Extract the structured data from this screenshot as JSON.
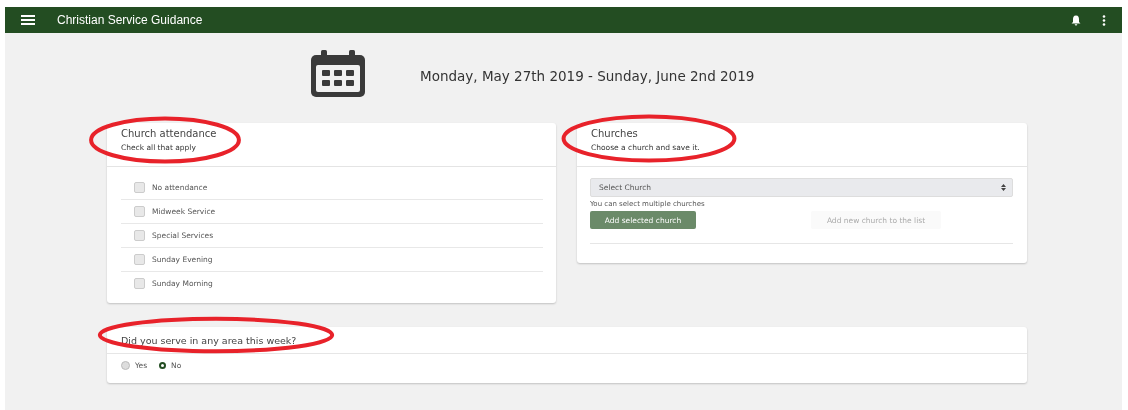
{
  "app_bar": {
    "title": "Christian Service Guidance"
  },
  "week": {
    "label": "Monday, May 27th 2019 - Sunday, June 2nd 2019"
  },
  "attendance_card": {
    "title": "Church attendance",
    "subtitle": "Check all that apply",
    "circled": true,
    "options": [
      {
        "label": "No attendance",
        "checked": false
      },
      {
        "label": "Midweek Service",
        "checked": false
      },
      {
        "label": "Special Services",
        "checked": false
      },
      {
        "label": "Sunday Evening",
        "checked": false
      },
      {
        "label": "Sunday Morning",
        "checked": false
      }
    ]
  },
  "churches_card": {
    "title": "Churches",
    "subtitle": "Choose a church and save it.",
    "circled": true,
    "select": {
      "placeholder": "Select Church"
    },
    "hint": "You can select multiple churches",
    "buttons": [
      {
        "label": "Add selected church",
        "kind": "primary"
      },
      {
        "label": "Add new church to the list",
        "kind": "flat"
      }
    ]
  },
  "serve_card": {
    "title": "Did you serve in any area this week?",
    "circled": true,
    "options": [
      {
        "label": "Yes",
        "selected": false
      },
      {
        "label": "No",
        "selected": true
      }
    ]
  }
}
